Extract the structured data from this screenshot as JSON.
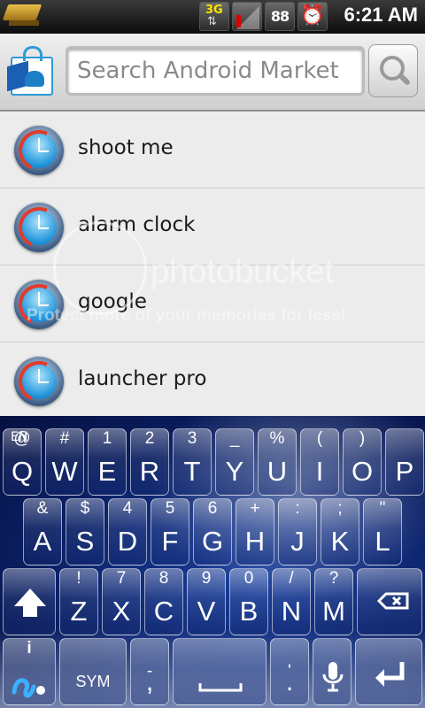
{
  "status_bar": {
    "network_type": "3G",
    "network_arrows": "⇅",
    "battery_readout": "88",
    "alarm_icon": "alarm-clock-icon",
    "time": "6:21 AM"
  },
  "header": {
    "search_placeholder": "Search Android Market",
    "search_icon": "magnifier-icon"
  },
  "list": {
    "items": [
      {
        "label": "shoot me"
      },
      {
        "label": "alarm clock"
      },
      {
        "label": "google"
      },
      {
        "label": "launcher pro"
      }
    ]
  },
  "watermark": {
    "text": "photobucket",
    "subtext": "Protect more of your memories for less!"
  },
  "keyboard": {
    "language": "EN",
    "row1": [
      {
        "alt": "@",
        "main": "Q"
      },
      {
        "alt": "#",
        "main": "W"
      },
      {
        "alt": "1",
        "main": "E"
      },
      {
        "alt": "2",
        "main": "R"
      },
      {
        "alt": "3",
        "main": "T"
      },
      {
        "alt": "_",
        "main": "Y"
      },
      {
        "alt": "%",
        "main": "U"
      },
      {
        "alt": "(",
        "main": "I"
      },
      {
        "alt": ")",
        "main": "O"
      },
      {
        "alt": "",
        "main": "P"
      }
    ],
    "row2": [
      {
        "alt": "&",
        "main": "A"
      },
      {
        "alt": "$",
        "main": "S"
      },
      {
        "alt": "4",
        "main": "D"
      },
      {
        "alt": "5",
        "main": "F"
      },
      {
        "alt": "6",
        "main": "G"
      },
      {
        "alt": "+",
        "main": "H"
      },
      {
        "alt": ":",
        "main": "J"
      },
      {
        "alt": ";",
        "main": "K"
      },
      {
        "alt": "\"",
        "main": "L"
      }
    ],
    "row3": [
      {
        "alt": "!",
        "main": "Z"
      },
      {
        "alt": "7",
        "main": "X"
      },
      {
        "alt": "8",
        "main": "C"
      },
      {
        "alt": "9",
        "main": "V"
      },
      {
        "alt": "0",
        "main": "B"
      },
      {
        "alt": "/",
        "main": "N"
      },
      {
        "alt": "?",
        "main": "M"
      }
    ],
    "shift_icon": "shift-arrow-icon",
    "delete_icon": "backspace-icon",
    "bottom": {
      "settings_alt": "i",
      "sym": "SYM",
      "dash_alt": "-",
      "dash_main": ",",
      "space": "",
      "quote_alt": "'",
      "period": ".",
      "mic_icon": "microphone-icon",
      "enter_icon": "enter-arrow-icon"
    }
  }
}
